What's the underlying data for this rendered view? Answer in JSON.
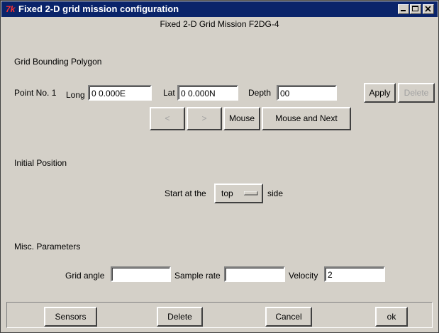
{
  "window": {
    "title": "Fixed 2-D grid mission configuration",
    "app_icon": "tk-feather-icon",
    "controls": [
      "minimize-icon",
      "maximize-icon",
      "close-icon"
    ]
  },
  "mission_title": "Fixed 2-D Grid Mission F2DG-4",
  "polygon": {
    "heading": "Grid Bounding Polygon",
    "point_label": "Point No.",
    "point_no": "1",
    "long_label": "Long",
    "long_value": "0 0.000E",
    "lat_label": "Lat",
    "lat_value": "0 0.000N",
    "depth_label": "Depth",
    "depth_value": "00",
    "apply_label": "Apply",
    "delete_label": "Delete",
    "prev_label": "<",
    "next_label": ">",
    "mouse_label": "Mouse",
    "mouse_next_label": "Mouse and Next"
  },
  "initial": {
    "heading": "Initial Position",
    "start_label": "Start at the",
    "side_value": "top",
    "side_suffix": "side"
  },
  "misc": {
    "heading": "Misc. Parameters",
    "grid_angle_label": "Grid angle",
    "grid_angle_value": "",
    "sample_rate_label": "Sample rate",
    "sample_rate_value": "",
    "velocity_label": "Velocity",
    "velocity_value": "2"
  },
  "footer": {
    "sensors_label": "Sensors",
    "delete_label": "Delete",
    "cancel_label": "Cancel",
    "ok_label": "ok"
  }
}
